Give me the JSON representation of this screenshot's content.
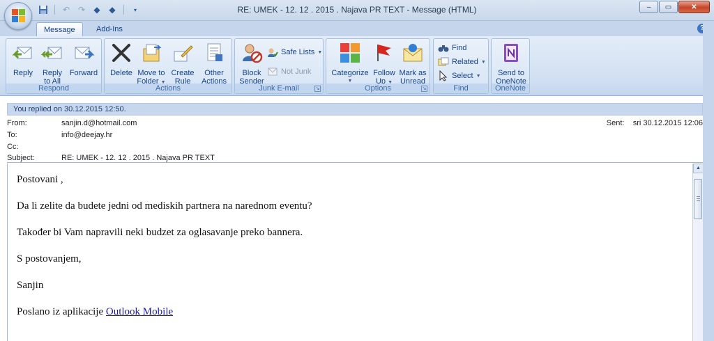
{
  "window": {
    "title": "RE: UMEK - 12. 12 . 2015 . Najava PR TEXT  -  Message (HTML)",
    "minimize": "‒",
    "maximize": "▭",
    "close": "✕"
  },
  "quick_access": [
    "save-icon",
    "undo-icon",
    "redo-icon",
    "previous-item-icon",
    "next-item-icon"
  ],
  "tabs": [
    {
      "label": "Message",
      "active": true
    },
    {
      "label": "Add-Ins",
      "active": false
    }
  ],
  "help": "?",
  "ribbon": {
    "respond": {
      "label": "Respond",
      "reply": "Reply",
      "reply_all_1": "Reply",
      "reply_all_2": "to All",
      "forward": "Forward"
    },
    "actions": {
      "label": "Actions",
      "delete": "Delete",
      "move_1": "Move to",
      "move_2": "Folder",
      "create_1": "Create",
      "create_2": "Rule",
      "other_1": "Other",
      "other_2": "Actions"
    },
    "junk": {
      "label": "Junk E-mail",
      "block_1": "Block",
      "block_2": "Sender",
      "safe_lists": "Safe Lists",
      "not_junk": "Not Junk"
    },
    "options": {
      "label": "Options",
      "categorize": "Categorize",
      "follow_1": "Follow",
      "follow_2": "Up",
      "mark_1": "Mark as",
      "mark_2": "Unread"
    },
    "find": {
      "label": "Find",
      "find": "Find",
      "related": "Related",
      "select": "Select"
    },
    "onenote": {
      "label": "OneNote",
      "send_1": "Send to",
      "send_2": "OneNote"
    }
  },
  "infobar": "You replied on 30.12.2015 12:50.",
  "headers": {
    "from_label": "From:",
    "from": "sanjin.d@hotmail.com",
    "to_label": "To:",
    "to": "info@deejay.hr",
    "cc_label": "Cc:",
    "cc": "",
    "subject_label": "Subject:",
    "subject": "RE: UMEK - 12. 12 . 2015 . Najava PR TEXT",
    "sent_label": "Sent:",
    "sent": "sri 30.12.2015 12:06"
  },
  "body": {
    "p1": "Postovani ,",
    "p2": "Da li zelite da budete jedni od mediskih partnera na narednom eventu?",
    "p3": "Također bi Vam napravili neki budzet za oglasavanje preko bannera.",
    "p4": "S postovanjem,",
    "p5": "Sanjin",
    "p6_prefix": "Poslano iz aplikacije ",
    "p6_link": "Outlook Mobile"
  },
  "colors": {
    "ribbon_text": "#15428b",
    "infobar": "#c7d8ee",
    "link": "#1a1aa8",
    "close_button": "#c74427"
  }
}
